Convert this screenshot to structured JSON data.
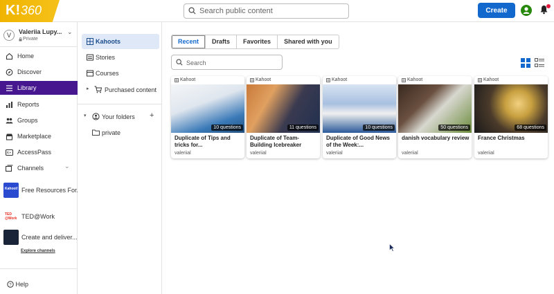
{
  "brand": {
    "logo_text": "K!",
    "logo_suffix": "360",
    "accent": "#46178f",
    "primary": "#1368ce"
  },
  "header": {
    "search_placeholder": "Search public content",
    "create_label": "Create"
  },
  "user": {
    "initial": "V",
    "name": "Valeriia Lupy...",
    "visibility": "Private"
  },
  "nav": [
    {
      "label": "Home",
      "icon": "home-icon"
    },
    {
      "label": "Discover",
      "icon": "compass-icon"
    },
    {
      "label": "Library",
      "icon": "library-icon",
      "active": true
    },
    {
      "label": "Reports",
      "icon": "reports-icon"
    },
    {
      "label": "Groups",
      "icon": "groups-icon"
    },
    {
      "label": "Marketplace",
      "icon": "marketplace-icon"
    },
    {
      "label": "AccessPass",
      "icon": "accesspass-icon"
    },
    {
      "label": "Channels",
      "icon": "channels-icon"
    }
  ],
  "channels": [
    {
      "label": "Free Resources For...",
      "thumb_text": "Kahoot!"
    },
    {
      "label": "TED@Work",
      "thumb_text": "TED @Work"
    },
    {
      "label": "Create and deliver..."
    }
  ],
  "explore_label": "Explore channels",
  "help_label": "Help",
  "folders": {
    "items": [
      {
        "label": "Kahoots",
        "active": true
      },
      {
        "label": "Stories"
      },
      {
        "label": "Courses"
      },
      {
        "label": "Purchased content"
      }
    ],
    "your_folders_label": "Your folders",
    "subfolders": [
      {
        "label": "private"
      }
    ]
  },
  "tabs": [
    {
      "label": "Recent",
      "active": true
    },
    {
      "label": "Drafts"
    },
    {
      "label": "Favorites"
    },
    {
      "label": "Shared with you"
    }
  ],
  "library_search_placeholder": "Search",
  "cards": [
    {
      "type": "Kahoot",
      "questions": "10 questions",
      "title": "Duplicate of Tips and tricks for...",
      "author": "valeriial",
      "colors": [
        "#f4f6f8",
        "#3a7ab8"
      ]
    },
    {
      "type": "Kahoot",
      "questions": "11 questions",
      "title": "Duplicate of Team-Building Icebreaker",
      "author": "valeriial",
      "colors": [
        "#c97a3a",
        "#203050"
      ]
    },
    {
      "type": "Kahoot",
      "questions": "10 questions",
      "title": "Duplicate of Good News of the Week:...",
      "author": "valeriial",
      "colors": [
        "#d8e4f2",
        "#2a5a9a"
      ]
    },
    {
      "type": "Kahoot",
      "questions": "50 questions",
      "title": "danish vocabulary review",
      "author": "valeriial",
      "colors": [
        "#3a2a20",
        "#6a8a3a"
      ]
    },
    {
      "type": "Kahoot",
      "questions": "68 questions",
      "title": "France Christmas",
      "author": "valeriial",
      "colors": [
        "#2a2a2a",
        "#c8a040"
      ]
    }
  ]
}
